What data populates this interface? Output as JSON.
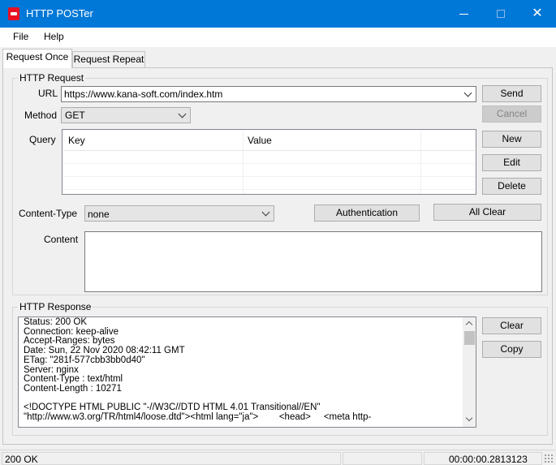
{
  "window": {
    "title": "HTTP POSTer",
    "minimize": "—",
    "maximize": "☐",
    "close": "✕"
  },
  "menu": [
    "File",
    "Help"
  ],
  "tabs": [
    "Request Once",
    "Request Repeat"
  ],
  "request": {
    "group_title": "HTTP Request",
    "url_label": "URL",
    "url_value": "https://www.kana-soft.com/index.htm",
    "method_label": "Method",
    "method_value": "GET",
    "query_label": "Query",
    "query_columns": [
      "Key",
      "Value"
    ],
    "content_type_label": "Content-Type",
    "content_type_value": "none",
    "content_label": "Content",
    "content_value": ""
  },
  "buttons": {
    "send": "Send",
    "cancel": "Cancel",
    "new": "New",
    "edit": "Edit",
    "delete": "Delete",
    "authentication": "Authentication",
    "all_clear": "All Clear",
    "clear": "Clear",
    "copy": "Copy"
  },
  "response": {
    "group_title": "HTTP Response",
    "text": "Status: 200 OK\nConnection: keep-alive\nAccept-Ranges: bytes\nDate: Sun, 22 Nov 2020 08:42:11 GMT\nETag: \"281f-577cbb3bb0d40\"\nServer: nginx\nContent-Type : text/html\nContent-Length : 10271\n\n<!DOCTYPE HTML PUBLIC \"-//W3C//DTD HTML 4.01 Transitional//EN\"\n\"http://www.w3.org/TR/html4/loose.dtd\"><html lang=\"ja\">        <head>     <meta http-"
  },
  "status": {
    "left": "200 OK",
    "right": "00:00:00.2813123"
  }
}
